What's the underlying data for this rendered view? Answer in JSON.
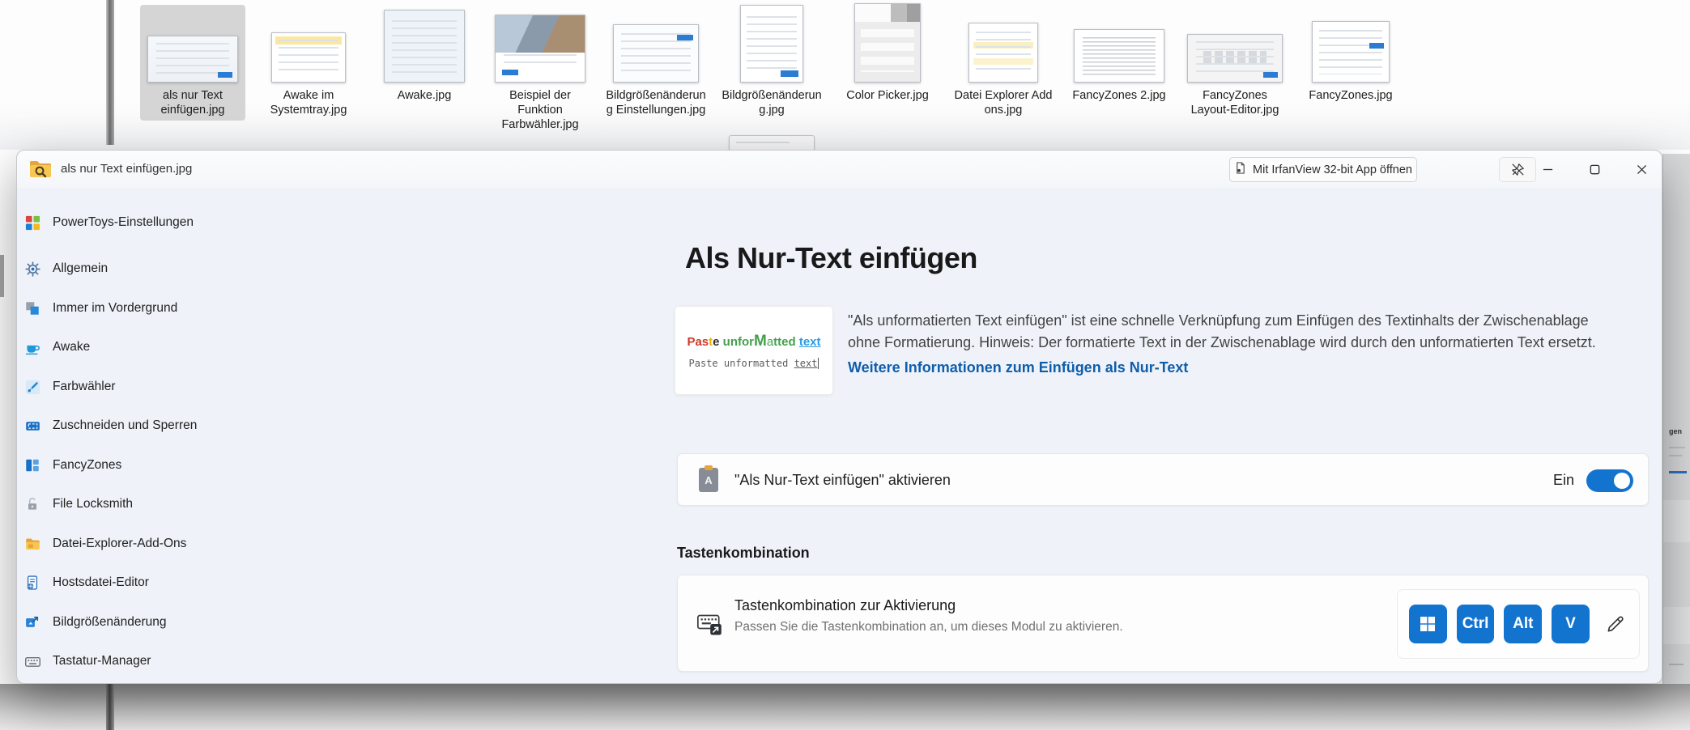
{
  "explorer_strip": {
    "items": [
      {
        "label": "als nur Text einfügen.jpg",
        "selected": true
      },
      {
        "label": "Awake im Systemtray.jpg",
        "selected": false
      },
      {
        "label": "Awake.jpg",
        "selected": false
      },
      {
        "label": "Beispiel der Funktion Farbwähler.jpg",
        "selected": false
      },
      {
        "label": "Bildgrößenänderung Einstellungen.jpg",
        "selected": false
      },
      {
        "label": "Bildgrößenänderung.jpg",
        "selected": false
      },
      {
        "label": "Color Picker.jpg",
        "selected": false
      },
      {
        "label": "Datei Explorer Add ons.jpg",
        "selected": false
      },
      {
        "label": "FancyZones 2.jpg",
        "selected": false
      },
      {
        "label": "FancyZones Layout-Editor.jpg",
        "selected": false
      },
      {
        "label": "FancyZones.jpg",
        "selected": false
      }
    ]
  },
  "peek_window": {
    "titlebar": {
      "title": "als nur Text einfügen.jpg",
      "open_with_button": "Mit IrfanView 32-bit App öffnen"
    },
    "sidebar": {
      "header": "PowerToys-Einstellungen",
      "items": [
        {
          "label": "Allgemein",
          "icon": "gear-icon"
        },
        {
          "label": "Immer im Vordergrund",
          "icon": "always-on-top-icon"
        },
        {
          "label": "Awake",
          "icon": "coffee-cup-icon"
        },
        {
          "label": "Farbwähler",
          "icon": "color-picker-icon"
        },
        {
          "label": "Zuschneiden und Sperren",
          "icon": "crop-lock-icon"
        },
        {
          "label": "FancyZones",
          "icon": "fancyzones-icon"
        },
        {
          "label": "File Locksmith",
          "icon": "padlock-icon"
        },
        {
          "label": "Datei-Explorer-Add-Ons",
          "icon": "folder-icon"
        },
        {
          "label": "Hostsdatei-Editor",
          "icon": "document-icon"
        },
        {
          "label": "Bildgrößenänderung",
          "icon": "image-resize-icon"
        },
        {
          "label": "Tastatur-Manager",
          "icon": "keyboard-icon"
        }
      ]
    },
    "main": {
      "title": "Als Nur-Text einfügen",
      "hero_image": {
        "line1_parts": [
          "Pas",
          "t",
          "e",
          " unfor",
          "M",
          "a",
          "tted ",
          "text"
        ],
        "line2_pre": "Paste unformatted ",
        "line2_underlined": "text"
      },
      "description": "\"Als unformatierten Text einfügen\" ist eine schnelle Verknüpfung zum Einfügen des Textinhalts der Zwischenablage ohne Formatierung. Hinweis: Der formatierte Text in der Zwischenablage wird durch den unformatierten Text ersetzt.",
      "learn_more_link": "Weitere Informationen zum Einfügen als Nur-Text",
      "enable_row": {
        "label": "\"Als Nur-Text einfügen\" aktivieren",
        "state_label": "Ein",
        "enabled": true
      },
      "shortcut_section": {
        "header": "Tastenkombination",
        "row_title": "Tastenkombination zur Aktivierung",
        "row_subtitle": "Passen Sie die Tastenkombination an, um dieses Modul zu aktivieren.",
        "keys": [
          {
            "icon": "windows-logo-icon",
            "label": ""
          },
          {
            "label": "Ctrl"
          },
          {
            "label": "Alt"
          },
          {
            "label": "V"
          }
        ]
      }
    }
  },
  "background_window": {
    "fragment": "gen"
  },
  "colors": {
    "accent": "#1374cf",
    "link_blue": "#0f5dab",
    "selected_tile": "#d5d5d5",
    "key_blue": "#1374cf"
  }
}
